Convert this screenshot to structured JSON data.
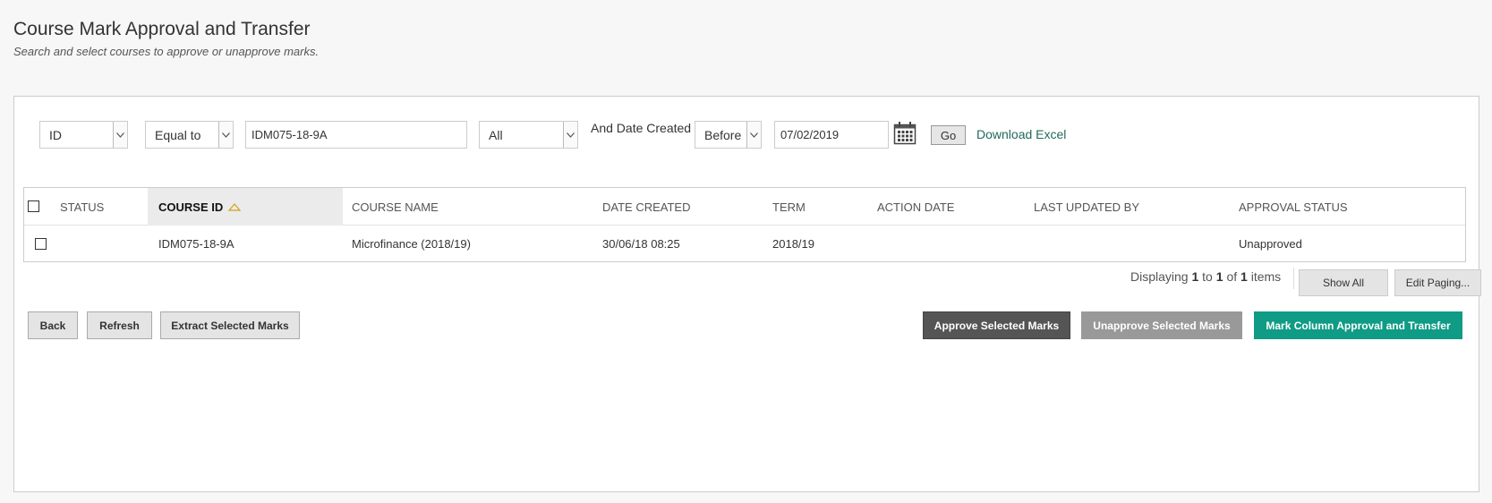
{
  "header": {
    "title": "Course Mark Approval and Transfer",
    "subtitle": "Search and select courses to approve or unapprove marks."
  },
  "filters": {
    "field_select": "ID",
    "operator_select": "Equal to",
    "search_value": "IDM075-18-9A",
    "scope_select": "All",
    "date_label": "And Date Created",
    "date_operator": "Before",
    "date_value": "07/02/2019",
    "go_label": "Go",
    "download_label": "Download Excel"
  },
  "table": {
    "columns": [
      "Status",
      "Course ID",
      "Course Name",
      "Date Created",
      "Term",
      "Action Date",
      "Last Updated By",
      "Approval Status"
    ],
    "sorted_column": "Course ID",
    "rows": [
      {
        "status": "",
        "course_id": "IDM075-18-9A",
        "course_name": "Microfinance (2018/19)",
        "date_created": "30/06/18 08:25",
        "term": "2018/19",
        "action_date": "",
        "last_updated_by": "",
        "approval_status": "Unapproved"
      }
    ]
  },
  "paging": {
    "prefix": "Displaying",
    "from": "1",
    "to_word": "to",
    "to": "1",
    "of_word": "of",
    "total": "1",
    "suffix": "items",
    "show_all": "Show All",
    "edit_paging": "Edit Paging..."
  },
  "actions": {
    "back": "Back",
    "refresh": "Refresh",
    "extract": "Extract Selected Marks",
    "approve": "Approve Selected Marks",
    "unapprove": "Unapprove Selected Marks",
    "mark_column": "Mark Column Approval and Transfer"
  },
  "colors": {
    "accent_teal": "#0f9b85",
    "link": "#22685d",
    "dark_button": "#555555"
  }
}
